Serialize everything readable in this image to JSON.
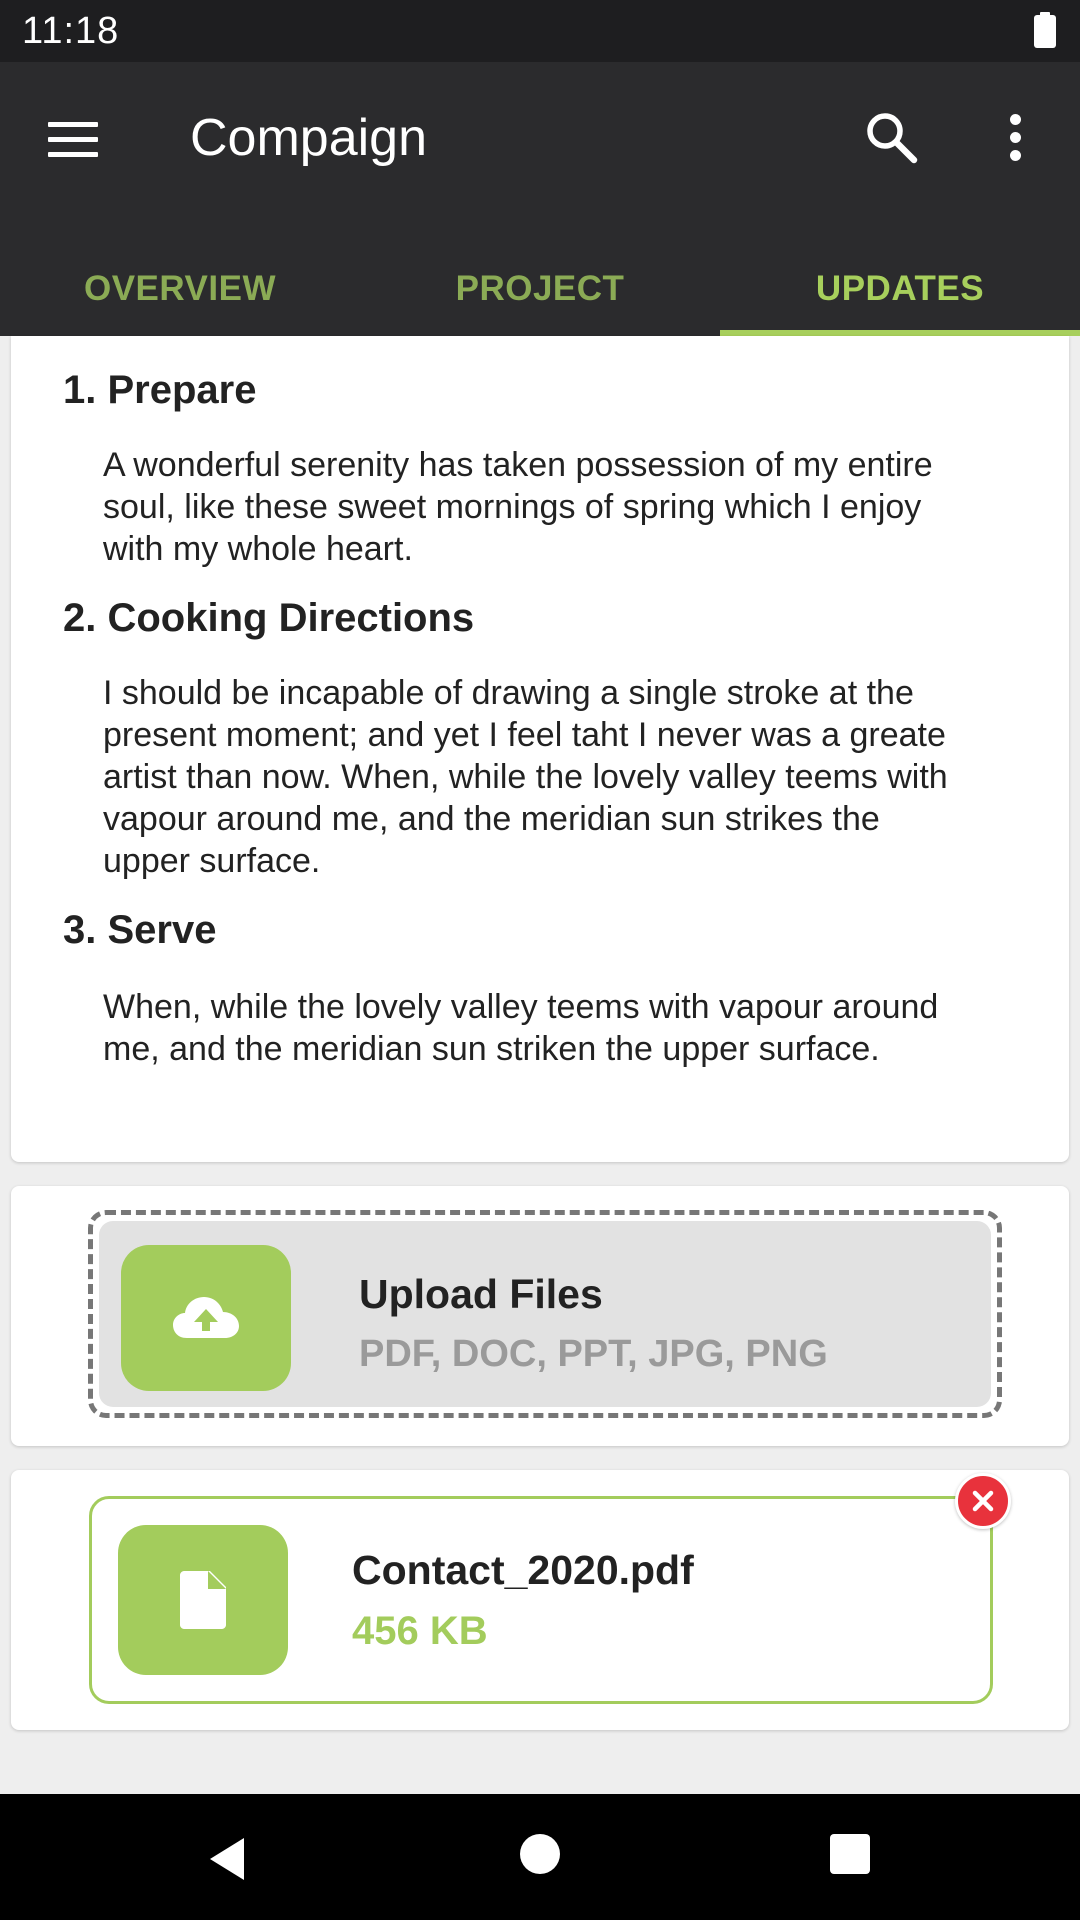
{
  "status_bar": {
    "time": "11:18"
  },
  "app_bar": {
    "title": "Compaign",
    "tabs": [
      {
        "label": "OVERVIEW",
        "active": false
      },
      {
        "label": "PROJECT",
        "active": false
      },
      {
        "label": "UPDATES",
        "active": true
      }
    ]
  },
  "content": {
    "steps": [
      {
        "title": "1. Prepare",
        "body": "A wonderful serenity has taken possession of my entire soul, like these sweet mornings of spring which I enjoy with my whole heart."
      },
      {
        "title": "2. Cooking Directions",
        "body": "I should be incapable of drawing a single stroke at the present moment; and yet I feel taht I never was a greate artist than now. When, while the lovely valley teems with vapour around me, and the meridian sun strikes the upper surface."
      },
      {
        "title": "3. Serve",
        "body": "When, while the lovely valley teems with vapour around me, and the meridian sun striken the upper surface."
      }
    ]
  },
  "upload": {
    "title": "Upload Files",
    "formats": "PDF, DOC, PPT, JPG, PNG",
    "icon": "cloud-upload-icon"
  },
  "file": {
    "name": "Contact_2020.pdf",
    "size": "456 KB",
    "icon": "file-icon"
  },
  "colors": {
    "accent": "#a3cc5c",
    "tab_active": "#a7cf5c",
    "tab_inactive": "#8bab55",
    "app_bar": "#2b2b2d",
    "remove": "#e8323c"
  }
}
